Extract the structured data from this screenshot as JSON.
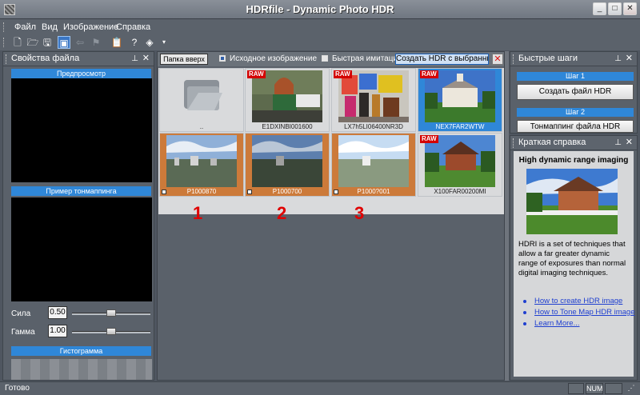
{
  "window": {
    "title": "HDRfile - Dynamic Photo HDR"
  },
  "menu": {
    "items": [
      "Файл",
      "Вид",
      "Изображение",
      "Справка"
    ]
  },
  "file_props": {
    "title": "Свойства файла",
    "preview_label": "Предпросмотр",
    "tonemap_label": "Пример тонмаппинга",
    "strength_label": "Сила",
    "strength_value": "0.50",
    "strength_level": 0.5,
    "gamma_label": "Гамма",
    "gamma_value": "1.00",
    "gamma_level": 0.5,
    "histogram_label": "Гистограмма"
  },
  "browser": {
    "up_button": "Папка вверх",
    "option_source": "Исходное изображение",
    "option_quick": "Быстрая имитация ",
    "create_button": "Создать HDR с выбранным",
    "close_button": "✕",
    "items": [
      {
        "name": "..",
        "raw": false,
        "folder": true
      },
      {
        "name": "E1DXINBI001600",
        "raw": true
      },
      {
        "name": "LX7h5LI06400NR3D",
        "raw": true
      },
      {
        "name": "NEX7FAR2WTW",
        "raw": true,
        "selected": true
      },
      {
        "name": "P1000870",
        "raw": false,
        "orange": true
      },
      {
        "name": "P1000700",
        "raw": false,
        "orange": true
      },
      {
        "name": "P1000?001",
        "raw": false,
        "orange": true
      },
      {
        "name": "X100FAR00200MI",
        "raw": true
      }
    ],
    "numbers": [
      "1",
      "2",
      "3"
    ]
  },
  "quick_steps": {
    "title": "Быстрые шаги",
    "step1_label": "Шаг 1",
    "step1_button": "Создать файл HDR",
    "step2_label": "Шаг 2",
    "step2_button": "Тонмаппинг файла HDR"
  },
  "help": {
    "title": "Краткая справка",
    "heading": "High dynamic range imaging",
    "text": "HDRI is a set of techniques that allow a far greater dynamic range of exposures than normal digital imaging techniques.",
    "link1": "How to create HDR image",
    "link2": "How to Tone Map HDR image",
    "link3": "Learn More..."
  },
  "status": {
    "text": "Готово",
    "num": "NUM"
  }
}
